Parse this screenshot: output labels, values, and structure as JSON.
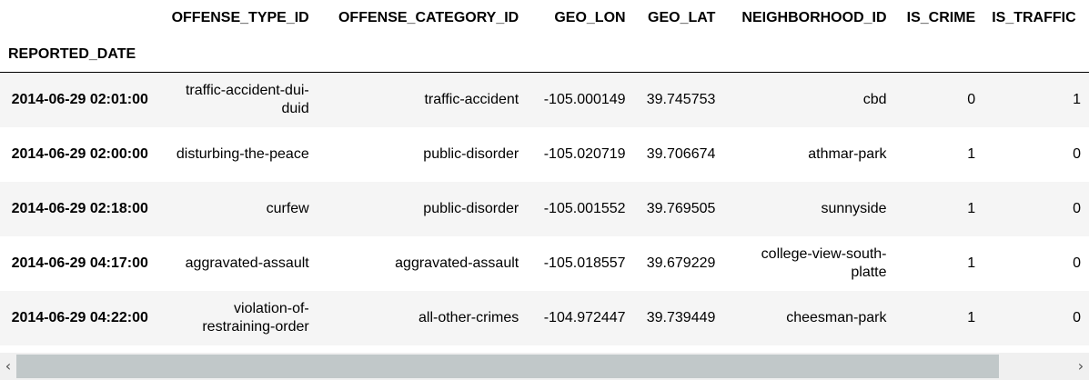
{
  "table": {
    "columns": [
      "OFFENSE_TYPE_ID",
      "OFFENSE_CATEGORY_ID",
      "GEO_LON",
      "GEO_LAT",
      "NEIGHBORHOOD_ID",
      "IS_CRIME",
      "IS_TRAFFIC"
    ],
    "index_name": "REPORTED_DATE",
    "rows": [
      {
        "index": "2014-06-29 02:01:00",
        "cells": [
          "traffic-accident-dui-duid",
          "traffic-accident",
          "-105.000149",
          "39.745753",
          "cbd",
          "0",
          "1"
        ]
      },
      {
        "index": "2014-06-29 02:00:00",
        "cells": [
          "disturbing-the-peace",
          "public-disorder",
          "-105.020719",
          "39.706674",
          "athmar-park",
          "1",
          "0"
        ]
      },
      {
        "index": "2014-06-29 02:18:00",
        "cells": [
          "curfew",
          "public-disorder",
          "-105.001552",
          "39.769505",
          "sunnyside",
          "1",
          "0"
        ]
      },
      {
        "index": "2014-06-29 04:17:00",
        "cells": [
          "aggravated-assault",
          "aggravated-assault",
          "-105.018557",
          "39.679229",
          "college-view-south-platte",
          "1",
          "0"
        ]
      },
      {
        "index": "2014-06-29 04:22:00",
        "cells": [
          "violation-of-restraining-order",
          "all-other-crimes",
          "-104.972447",
          "39.739449",
          "cheesman-park",
          "1",
          "0"
        ]
      }
    ]
  },
  "scrollbar": {
    "left_arrow_icon": "chevron-left-icon",
    "right_arrow_icon": "chevron-right-icon",
    "left_arrow_glyph": "‹",
    "right_arrow_glyph": "›",
    "thumb_fraction": 0.93,
    "scroll_position": 0
  },
  "colors": {
    "row_stripe": "#f5f5f5",
    "scroll_thumb": "#c1c8c9",
    "scroll_track": "#f0f0f0"
  }
}
